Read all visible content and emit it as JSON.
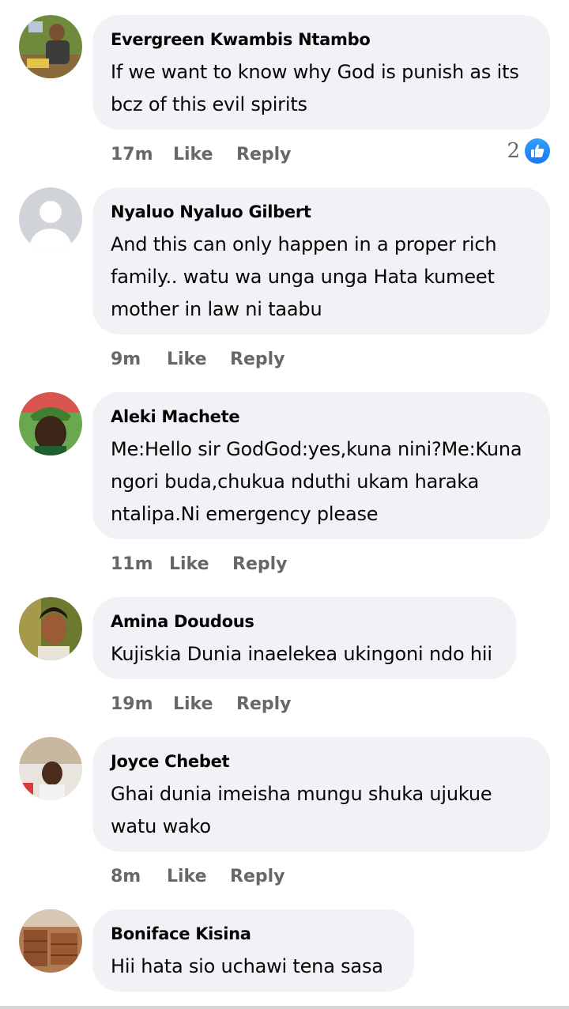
{
  "comments": [
    {
      "author": "Evergreen Kwambis Ntambo",
      "text": "If we want to know why God is punish as its bcz of this evil spirits",
      "time": "17m",
      "like_label": "Like",
      "reply_label": "Reply",
      "reaction_count": "2",
      "reaction_icon": "thumbs-up-icon",
      "accent": "#1877f2"
    },
    {
      "author": "Nyaluo Nyaluo Gilbert",
      "text": "And this can only happen in a proper rich family.. watu wa unga unga Hata kumeet mother in law ni taabu",
      "time": "9m",
      "like_label": "Like",
      "reply_label": "Reply"
    },
    {
      "author": "Aleki Machete",
      "text": "Me:Hello sir GodGod:yes,kuna nini?Me:Kuna ngori buda,chukua nduthi ukam haraka ntalipa.Ni emergency please",
      "time": "11m",
      "like_label": "Like",
      "reply_label": "Reply"
    },
    {
      "author": "Amina Doudous",
      "text": "Kujiskia Dunia inaelekea ukingoni ndo hii",
      "time": "19m",
      "like_label": "Like",
      "reply_label": "Reply"
    },
    {
      "author": "Joyce Chebet",
      "text": "Ghai dunia imeisha mungu shuka ujukue watu wako",
      "time": "8m",
      "like_label": "Like",
      "reply_label": "Reply"
    },
    {
      "author": "Boniface Kisina",
      "text": "Hii hata sio uchawi tena sasa"
    }
  ]
}
